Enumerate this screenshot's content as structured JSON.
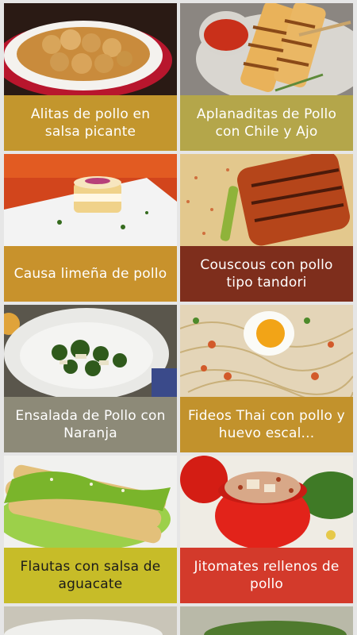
{
  "recipes": [
    {
      "title": "Alitas de pollo en salsa picante",
      "caption_bg": "#c3962d",
      "caption_color": "#ffffff",
      "photo_icon": "chicken-wings-dish-photo"
    },
    {
      "title": "Aplanaditas de Pollo con Chile y Ajo",
      "caption_bg": "#b4a64a",
      "caption_color": "#ffffff",
      "photo_icon": "grilled-chicken-skewers-photo"
    },
    {
      "title": "Causa limeña de pollo",
      "caption_bg": "#c8922c",
      "caption_color": "#ffffff",
      "photo_icon": "causa-dish-photo"
    },
    {
      "title": "Couscous con pollo tipo tandori",
      "caption_bg": "#7e2e1c",
      "caption_color": "#ffffff",
      "photo_icon": "tandoori-chicken-couscous-photo"
    },
    {
      "title": "Ensalada de Pollo con Naranja",
      "caption_bg": "#8d8a78",
      "caption_color": "#ffffff",
      "photo_icon": "chicken-salad-bowl-photo"
    },
    {
      "title": "Fideos Thai con pollo y huevo escal...",
      "caption_bg": "#c2922c",
      "caption_color": "#ffffff",
      "photo_icon": "thai-noodles-egg-photo"
    },
    {
      "title": "Flautas con salsa de aguacate",
      "caption_bg": "#c7bc28",
      "caption_color": "#1b1b1b",
      "photo_icon": "flautas-avocado-sauce-photo"
    },
    {
      "title": "Jitomates rellenos de pollo",
      "caption_bg": "#d33a2b",
      "caption_color": "#ffffff",
      "photo_icon": "stuffed-tomatoes-photo"
    }
  ]
}
